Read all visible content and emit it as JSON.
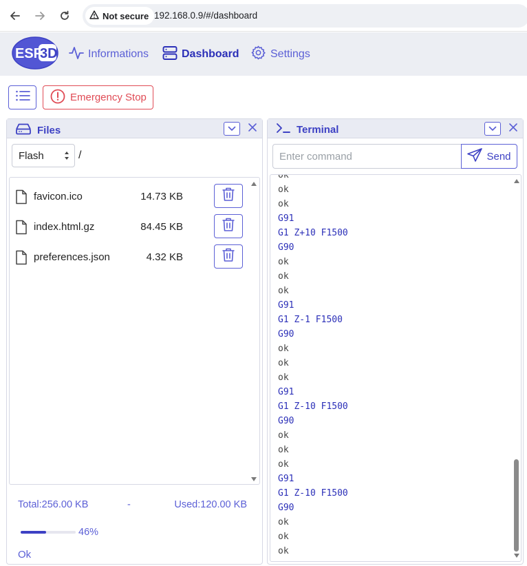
{
  "browser": {
    "security_label": "Not secure",
    "url": "192.168.0.9/#/dashboard"
  },
  "nav": {
    "logo_text_left": "ESP",
    "logo_text_right": "3D",
    "items": [
      {
        "label": "Informations",
        "icon": "activity-icon"
      },
      {
        "label": "Dashboard",
        "icon": "server-icon"
      },
      {
        "label": "Settings",
        "icon": "gear-icon"
      }
    ]
  },
  "toolbar": {
    "emergency_label": "Emergency Stop"
  },
  "files": {
    "title": "Files",
    "filesystem": "Flash",
    "path": "/",
    "items": [
      {
        "name": "favicon.ico",
        "size": "14.73 KB"
      },
      {
        "name": "index.html.gz",
        "size": "84.45 KB"
      },
      {
        "name": "preferences.json",
        "size": "4.32 KB"
      }
    ],
    "total": "Total:256.00 KB",
    "separator": "-",
    "used": "Used:120.00 KB",
    "usage_percent": 46,
    "usage_label": "46%",
    "status": "Ok"
  },
  "terminal": {
    "title": "Terminal",
    "placeholder": "Enter command",
    "send_label": "Send",
    "lines": [
      {
        "text": "ok",
        "kind": "resp"
      },
      {
        "text": "ok",
        "kind": "resp"
      },
      {
        "text": "ok",
        "kind": "resp"
      },
      {
        "text": "G91",
        "kind": "cmd"
      },
      {
        "text": "G1 Z+10 F1500",
        "kind": "cmd"
      },
      {
        "text": "G90",
        "kind": "cmd"
      },
      {
        "text": "ok",
        "kind": "resp"
      },
      {
        "text": "ok",
        "kind": "resp"
      },
      {
        "text": "ok",
        "kind": "resp"
      },
      {
        "text": "G91",
        "kind": "cmd"
      },
      {
        "text": "G1 Z-1 F1500",
        "kind": "cmd"
      },
      {
        "text": "G90",
        "kind": "cmd"
      },
      {
        "text": "ok",
        "kind": "resp"
      },
      {
        "text": "ok",
        "kind": "resp"
      },
      {
        "text": "ok",
        "kind": "resp"
      },
      {
        "text": "G91",
        "kind": "cmd"
      },
      {
        "text": "G1 Z-10 F1500",
        "kind": "cmd"
      },
      {
        "text": "G90",
        "kind": "cmd"
      },
      {
        "text": "ok",
        "kind": "resp"
      },
      {
        "text": "ok",
        "kind": "resp"
      },
      {
        "text": "ok",
        "kind": "resp"
      },
      {
        "text": "G91",
        "kind": "cmd"
      },
      {
        "text": "G1 Z-10 F1500",
        "kind": "cmd"
      },
      {
        "text": "G90",
        "kind": "cmd"
      },
      {
        "text": "ok",
        "kind": "resp"
      },
      {
        "text": "ok",
        "kind": "resp"
      },
      {
        "text": "ok",
        "kind": "resp"
      }
    ]
  },
  "colors": {
    "accent": "#5b5fd6",
    "accent_dark": "#2b2fb8",
    "danger": "#e04b55",
    "panel_header": "#e9ebf3"
  }
}
